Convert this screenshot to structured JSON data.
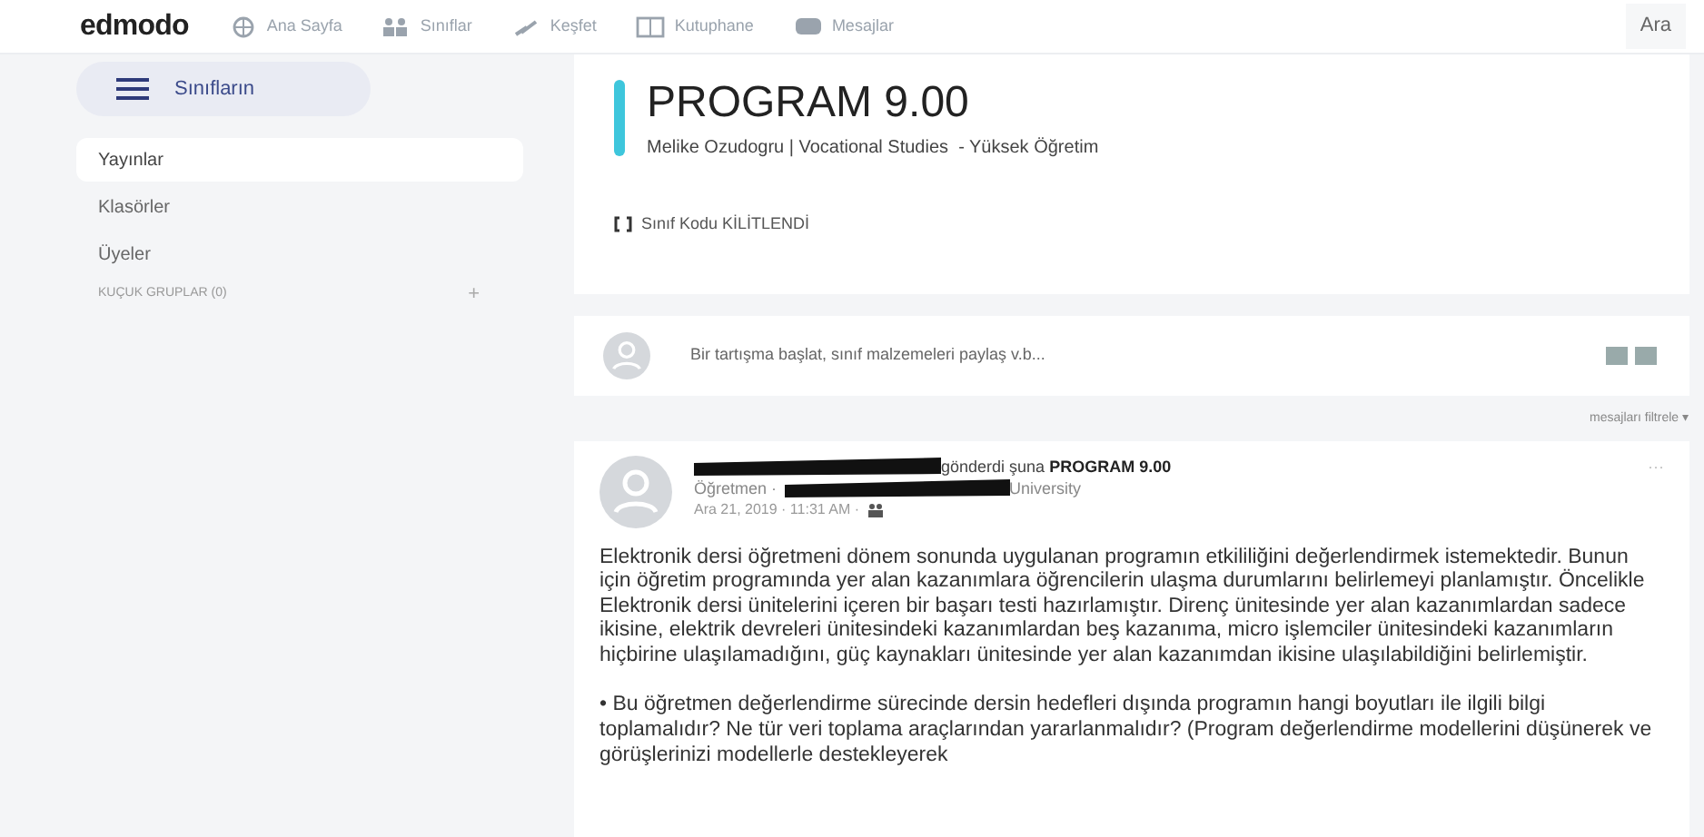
{
  "topbar": {
    "logo": "edmodo",
    "nav": [
      {
        "label": "Ana Sayfa"
      },
      {
        "label": "Sınıflar"
      },
      {
        "label": "Keşfet"
      },
      {
        "label": "Kutuphane"
      },
      {
        "label": "Mesajlar"
      }
    ],
    "search": "Ara"
  },
  "sidebar": {
    "classes_button": "Sınıfların",
    "items": [
      {
        "label": "Yayınlar",
        "selected": true
      },
      {
        "label": "Klasörler",
        "selected": false
      },
      {
        "label": "Üyeler",
        "selected": false
      }
    ],
    "groups": {
      "label": "KUÇUK GRUPLAR (0)",
      "add": "+"
    }
  },
  "class_header": {
    "title": "PROGRAM 9.00",
    "subtitle": "Melike Ozudogru | Vocational Studies  - Yüksek Öğretim",
    "code": "Sınıf Kodu KİLİTLENDİ"
  },
  "composer": {
    "placeholder": "Bir tartışma başlat, sınıf malzemeleri paylaş v.b..."
  },
  "filter": "mesajları filtrele ▾",
  "post": {
    "sent_to": "gönderdi şuna",
    "class": "PROGRAM 9.00",
    "role": "Öğretmen ·",
    "school": "University",
    "time": "Ara 21, 2019 · 11:31 AM ·",
    "more": "···",
    "paragraphs": [
      "Elektronik dersi öğretmeni dönem sonunda uygulanan programın etkililiğini değerlendirmek istemektedir. Bunun için öğretim programında yer alan kazanımlara öğrencilerin ulaşma durumlarını belirlemeyi planlamıştır. Öncelikle Elektronik dersi ünitelerini içeren bir başarı testi hazırlamıştır. Direnç ünitesinde yer alan kazanımlardan sadece ikisine, elektrik devreleri ünitesindeki kazanımlardan beş kazanıma, micro işlemciler ünitesindeki kazanımların hiçbirine ulaşılamadığını, güç kaynakları ünitesinde yer alan kazanımdan ikisine ulaşılabildiğini belirlemiştir.",
      "• Bu öğretmen değerlendirme sürecinde dersin hedefleri dışında programın hangi boyutları ile ilgili bilgi toplamalıdır?  Ne tür veri toplama araçlarından yararlanmalıdır? (Program değerlendirme modellerini düşünerek ve görüşlerinizi modellerle destekleyerek"
    ]
  }
}
